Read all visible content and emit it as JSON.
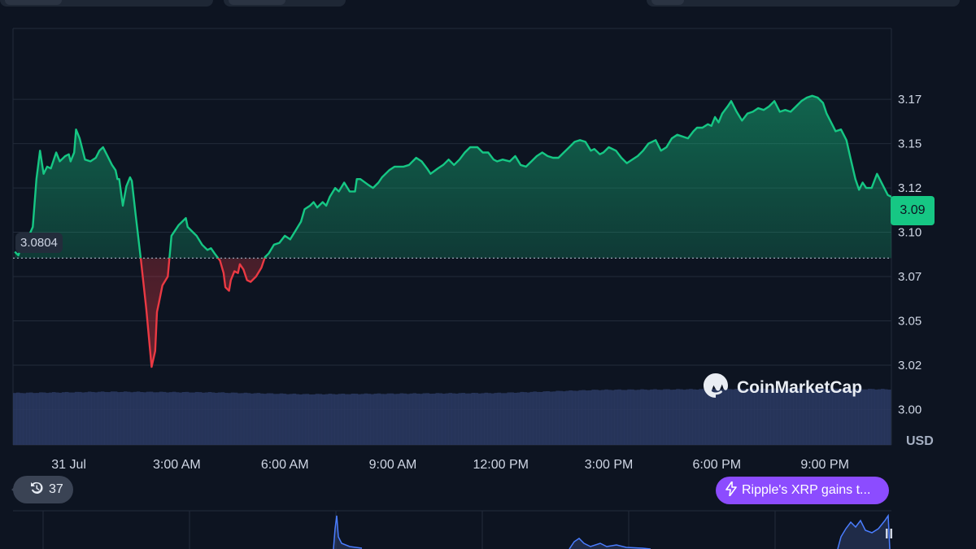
{
  "chart_data": {
    "type": "line",
    "currency": "USD",
    "reference_price": 3.0804,
    "reference_label": "3.0804",
    "current_label": "3.09",
    "y_ticks": [
      "3.17",
      "3.15",
      "3.12",
      "3.10",
      "3.07",
      "3.05",
      "3.02",
      "3.00"
    ],
    "y_tick_values": [
      3.17,
      3.145,
      3.12,
      3.095,
      3.07,
      3.045,
      3.02,
      2.995
    ],
    "x_ticks": [
      "31 Jul",
      "3:00 AM",
      "6:00 AM",
      "9:00 AM",
      "12:00 PM",
      "3:00 PM",
      "6:00 PM",
      "9:00 PM"
    ],
    "x_tick_hours": [
      0,
      3,
      6,
      9,
      12,
      15,
      18,
      21
    ],
    "xlim_hours": [
      -1.55,
      22.85
    ],
    "ylim": [
      2.975,
      3.21
    ],
    "colors": {
      "up": "#16c784",
      "down": "#ea3943",
      "volume": "#2b3a63",
      "grid": "#222b3a"
    },
    "series": [
      {
        "points": [
          [
            -1.5,
            3.084
          ],
          [
            -1.4,
            3.082
          ],
          [
            -1.3,
            3.088
          ],
          [
            -1.15,
            3.091
          ],
          [
            -1.0,
            3.098
          ],
          [
            -0.9,
            3.125
          ],
          [
            -0.8,
            3.141
          ],
          [
            -0.7,
            3.128
          ],
          [
            -0.6,
            3.132
          ],
          [
            -0.5,
            3.131
          ],
          [
            -0.35,
            3.14
          ],
          [
            -0.25,
            3.135
          ],
          [
            -0.1,
            3.138
          ],
          [
            0.0,
            3.139
          ],
          [
            0.05,
            3.135
          ],
          [
            0.15,
            3.14
          ],
          [
            0.2,
            3.153
          ],
          [
            0.3,
            3.148
          ],
          [
            0.45,
            3.136
          ],
          [
            0.6,
            3.135
          ],
          [
            0.75,
            3.137
          ],
          [
            0.85,
            3.141
          ],
          [
            0.95,
            3.143
          ],
          [
            1.05,
            3.139
          ],
          [
            1.2,
            3.133
          ],
          [
            1.3,
            3.13
          ],
          [
            1.35,
            3.125
          ],
          [
            1.4,
            3.125
          ],
          [
            1.5,
            3.11
          ],
          [
            1.6,
            3.121
          ],
          [
            1.7,
            3.126
          ],
          [
            1.75,
            3.124
          ],
          [
            1.85,
            3.106
          ],
          [
            2.0,
            3.08
          ],
          [
            2.15,
            3.052
          ],
          [
            2.3,
            3.019
          ],
          [
            2.4,
            3.028
          ],
          [
            2.45,
            3.05
          ],
          [
            2.5,
            3.055
          ],
          [
            2.6,
            3.065
          ],
          [
            2.75,
            3.07
          ],
          [
            2.85,
            3.093
          ],
          [
            3.05,
            3.099
          ],
          [
            3.25,
            3.103
          ],
          [
            3.3,
            3.098
          ],
          [
            3.45,
            3.095
          ],
          [
            3.55,
            3.093
          ],
          [
            3.7,
            3.088
          ],
          [
            3.85,
            3.085
          ],
          [
            3.95,
            3.086
          ],
          [
            4.05,
            3.083
          ],
          [
            4.2,
            3.079
          ],
          [
            4.3,
            3.072
          ],
          [
            4.35,
            3.064
          ],
          [
            4.45,
            3.062
          ],
          [
            4.5,
            3.068
          ],
          [
            4.6,
            3.073
          ],
          [
            4.7,
            3.072
          ],
          [
            4.75,
            3.077
          ],
          [
            4.85,
            3.074
          ],
          [
            4.95,
            3.068
          ],
          [
            5.05,
            3.067
          ],
          [
            5.2,
            3.07
          ],
          [
            5.35,
            3.075
          ],
          [
            5.45,
            3.081
          ],
          [
            5.55,
            3.083
          ],
          [
            5.7,
            3.088
          ],
          [
            5.85,
            3.089
          ],
          [
            6.0,
            3.093
          ],
          [
            6.15,
            3.091
          ],
          [
            6.3,
            3.096
          ],
          [
            6.45,
            3.101
          ],
          [
            6.55,
            3.108
          ],
          [
            6.7,
            3.11
          ],
          [
            6.8,
            3.112
          ],
          [
            6.9,
            3.109
          ],
          [
            7.05,
            3.112
          ],
          [
            7.15,
            3.11
          ],
          [
            7.25,
            3.115
          ],
          [
            7.4,
            3.12
          ],
          [
            7.5,
            3.118
          ],
          [
            7.65,
            3.123
          ],
          [
            7.8,
            3.118
          ],
          [
            7.95,
            3.118
          ],
          [
            8.0,
            3.125
          ],
          [
            8.1,
            3.125
          ],
          [
            8.3,
            3.122
          ],
          [
            8.45,
            3.12
          ],
          [
            8.6,
            3.123
          ],
          [
            8.7,
            3.126
          ],
          [
            8.9,
            3.13
          ],
          [
            9.05,
            3.132
          ],
          [
            9.3,
            3.132
          ],
          [
            9.45,
            3.133
          ],
          [
            9.65,
            3.137
          ],
          [
            9.8,
            3.135
          ],
          [
            9.95,
            3.131
          ],
          [
            10.05,
            3.128
          ],
          [
            10.25,
            3.131
          ],
          [
            10.4,
            3.133
          ],
          [
            10.55,
            3.136
          ],
          [
            10.7,
            3.133
          ],
          [
            10.85,
            3.136
          ],
          [
            11.0,
            3.14
          ],
          [
            11.15,
            3.143
          ],
          [
            11.35,
            3.143
          ],
          [
            11.5,
            3.14
          ],
          [
            11.65,
            3.14
          ],
          [
            11.8,
            3.136
          ],
          [
            11.9,
            3.135
          ],
          [
            12.05,
            3.136
          ],
          [
            12.25,
            3.135
          ],
          [
            12.4,
            3.138
          ],
          [
            12.55,
            3.133
          ],
          [
            12.7,
            3.132
          ],
          [
            12.85,
            3.135
          ],
          [
            13.0,
            3.138
          ],
          [
            13.15,
            3.14
          ],
          [
            13.3,
            3.138
          ],
          [
            13.45,
            3.137
          ],
          [
            13.6,
            3.137
          ],
          [
            13.75,
            3.14
          ],
          [
            13.9,
            3.143
          ],
          [
            14.05,
            3.146
          ],
          [
            14.2,
            3.147
          ],
          [
            14.35,
            3.146
          ],
          [
            14.5,
            3.141
          ],
          [
            14.6,
            3.142
          ],
          [
            14.75,
            3.139
          ],
          [
            14.85,
            3.14
          ],
          [
            15.0,
            3.143
          ],
          [
            15.2,
            3.141
          ],
          [
            15.35,
            3.137
          ],
          [
            15.5,
            3.134
          ],
          [
            15.65,
            3.136
          ],
          [
            15.8,
            3.138
          ],
          [
            15.95,
            3.141
          ],
          [
            16.1,
            3.145
          ],
          [
            16.3,
            3.147
          ],
          [
            16.45,
            3.141
          ],
          [
            16.6,
            3.143
          ],
          [
            16.75,
            3.148
          ],
          [
            16.9,
            3.15
          ],
          [
            17.05,
            3.149
          ],
          [
            17.2,
            3.148
          ],
          [
            17.35,
            3.152
          ],
          [
            17.45,
            3.154
          ],
          [
            17.6,
            3.154
          ],
          [
            17.75,
            3.156
          ],
          [
            17.85,
            3.155
          ],
          [
            17.95,
            3.16
          ],
          [
            18.05,
            3.157
          ],
          [
            18.15,
            3.162
          ],
          [
            18.3,
            3.166
          ],
          [
            18.4,
            3.169
          ],
          [
            18.55,
            3.163
          ],
          [
            18.7,
            3.158
          ],
          [
            18.85,
            3.162
          ],
          [
            19.0,
            3.163
          ],
          [
            19.15,
            3.165
          ],
          [
            19.3,
            3.164
          ],
          [
            19.45,
            3.166
          ],
          [
            19.6,
            3.169
          ],
          [
            19.75,
            3.163
          ],
          [
            19.9,
            3.164
          ],
          [
            20.05,
            3.163
          ],
          [
            20.2,
            3.166
          ],
          [
            20.35,
            3.169
          ],
          [
            20.5,
            3.171
          ],
          [
            20.65,
            3.172
          ],
          [
            20.8,
            3.171
          ],
          [
            20.95,
            3.168
          ],
          [
            21.05,
            3.162
          ],
          [
            21.2,
            3.156
          ],
          [
            21.3,
            3.152
          ],
          [
            21.45,
            3.153
          ],
          [
            21.6,
            3.147
          ],
          [
            21.7,
            3.138
          ],
          [
            21.85,
            3.125
          ],
          [
            21.95,
            3.119
          ],
          [
            22.05,
            3.123
          ],
          [
            22.15,
            3.12
          ],
          [
            22.3,
            3.12
          ],
          [
            22.45,
            3.128
          ],
          [
            22.6,
            3.122
          ],
          [
            22.75,
            3.116
          ],
          [
            22.85,
            3.115
          ]
        ]
      }
    ],
    "volume_level": [
      0.84,
      0.86,
      0.85,
      0.82,
      0.83,
      0.84,
      0.89,
      0.9,
      0.91,
      0.9
    ]
  },
  "ui": {
    "brand_name": "CoinMarketCap",
    "history_count": "37",
    "news_text": "Ripple's XRP gains t...",
    "icons": [
      "history-icon",
      "lightning-icon",
      "coinmarketcap-logo-icon",
      "pause-icon"
    ]
  }
}
